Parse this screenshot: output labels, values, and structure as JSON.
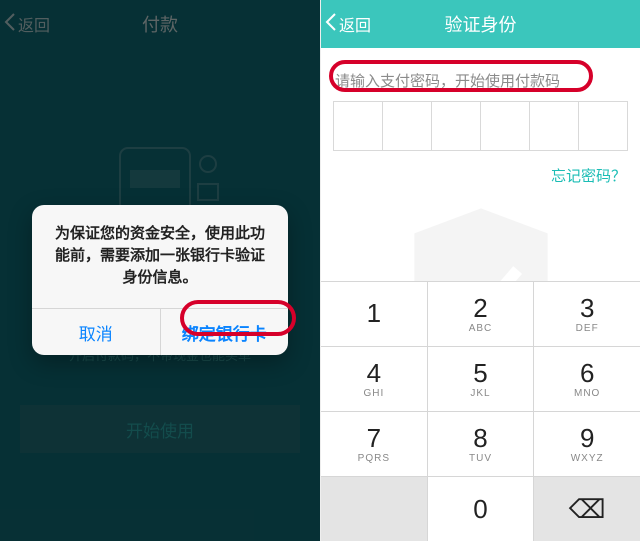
{
  "left": {
    "back_label": "返回",
    "title": "付款",
    "dialog_message": "为保证您的资金安全，使用此功能前，需要添加一张银行卡验证身份信息。",
    "dialog_cancel": "取消",
    "dialog_confirm": "绑定银行卡",
    "subtitle_hint": "开启付款码，不带现金也能买单",
    "start_button": "开始使用"
  },
  "right": {
    "back_label": "返回",
    "title": "验证身份",
    "prompt": "请输入支付密码，开始使用付款码",
    "forgot": "忘记密码？",
    "keys": [
      {
        "num": "1",
        "letters": ""
      },
      {
        "num": "2",
        "letters": "ABC"
      },
      {
        "num": "3",
        "letters": "DEF"
      },
      {
        "num": "4",
        "letters": "GHI"
      },
      {
        "num": "5",
        "letters": "JKL"
      },
      {
        "num": "6",
        "letters": "MNO"
      },
      {
        "num": "7",
        "letters": "PQRS"
      },
      {
        "num": "8",
        "letters": "TUV"
      },
      {
        "num": "9",
        "letters": "WXYZ"
      },
      {
        "num": "",
        "letters": ""
      },
      {
        "num": "0",
        "letters": ""
      },
      {
        "num": "⌫",
        "letters": ""
      }
    ]
  },
  "colors": {
    "accent_teal": "#3bc6bc",
    "highlight_ring": "#d6002a"
  }
}
